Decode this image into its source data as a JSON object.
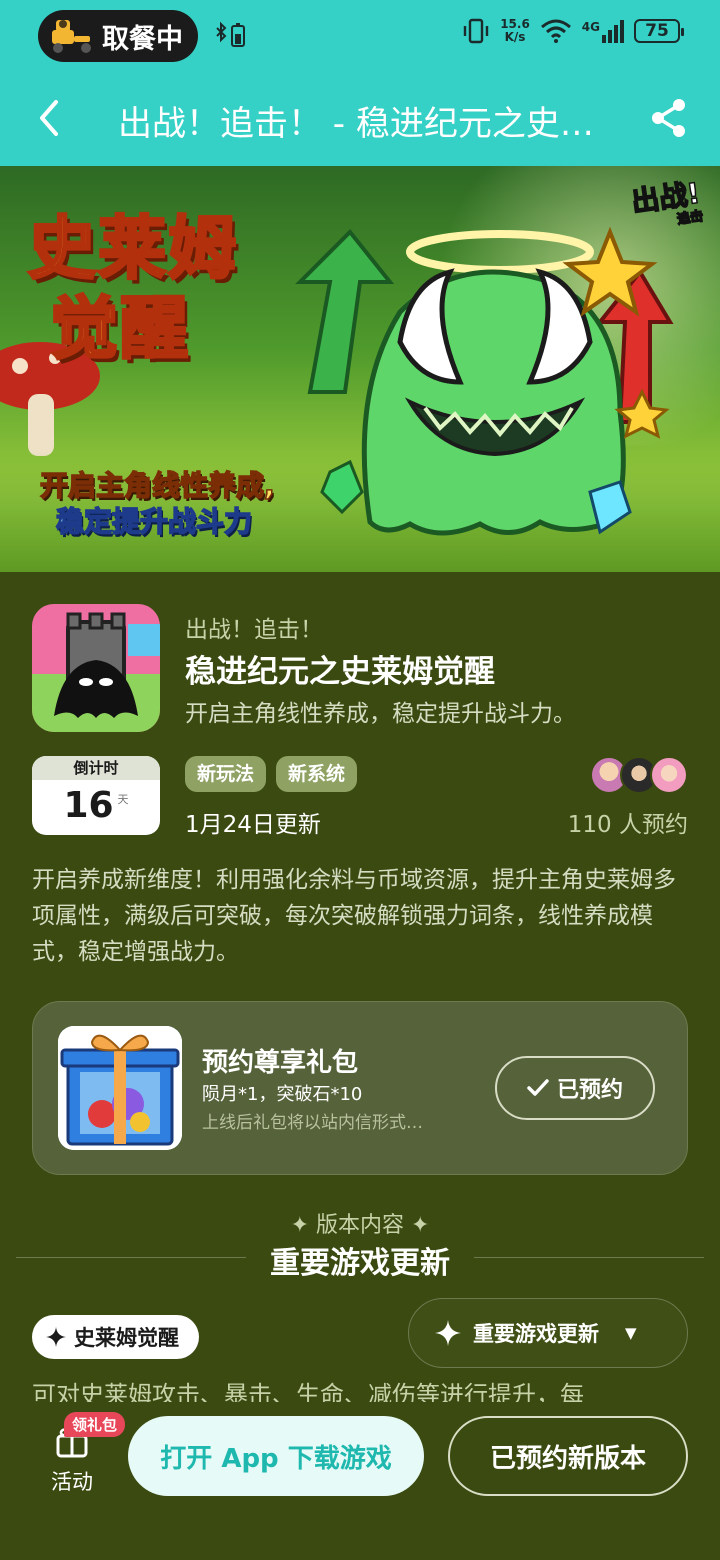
{
  "status_bar": {
    "pill_text": "取餐中",
    "net_speed_value": "15.6",
    "net_speed_unit": "K/s",
    "signal_label": "4G",
    "battery": "75"
  },
  "header": {
    "title": "出战！追击！ - 稳进纪元之史…",
    "back_icon": "back-arrow-icon",
    "share_icon": "share-icon"
  },
  "banner": {
    "title_line1": "史莱姆",
    "title_line2": "觉醒",
    "subtitle_line1": "开启主角线性养成,",
    "subtitle_line2": "稳定提升战斗力",
    "corner_logo": "出战!",
    "corner_logo_sub": "追击"
  },
  "game": {
    "developer": "出战！追击！",
    "title": "稳进纪元之史莱姆觉醒",
    "short_desc": "开启主角线性养成，稳定提升战斗力。",
    "countdown_label": "倒计时",
    "countdown_value": "16",
    "countdown_unit": "天",
    "tags": [
      "新玩法",
      "新系统"
    ],
    "update_date": "1月24日更新",
    "reserve_count": "110 人预约",
    "long_desc": "开启养成新维度！利用强化余料与币域资源，提升主角史莱姆多项属性，满级后可突破，每次突破解锁强力词条，线性养成模式，稳定增强战力。"
  },
  "gift": {
    "title": "预约尊享礼包",
    "items": "陨月*1，突破石*10",
    "note": "上线后礼包将以站内信形式…",
    "button": "已预约"
  },
  "section": {
    "kicker": "✦ 版本内容 ✦",
    "title": "重要游戏更新"
  },
  "content": {
    "chip_label": "史莱姆觉醒",
    "dropdown_label": "重要游戏更新",
    "first_line": "可对史莱姆攻击、暴击、生命、减伤等进行提升，每"
  },
  "bottom_bar": {
    "activity_label": "活动",
    "gift_badge": "领礼包",
    "open_button": "打开 App 下载游戏",
    "reserved_button": "已预约新版本"
  },
  "colors": {
    "header_bg": "#35d0c6",
    "page_bg": "#3a4a10",
    "card_bg": "#55623a",
    "tag_bg": "#8fa264",
    "accent_teal": "#1fb8ae",
    "badge_red": "#e8475a"
  }
}
